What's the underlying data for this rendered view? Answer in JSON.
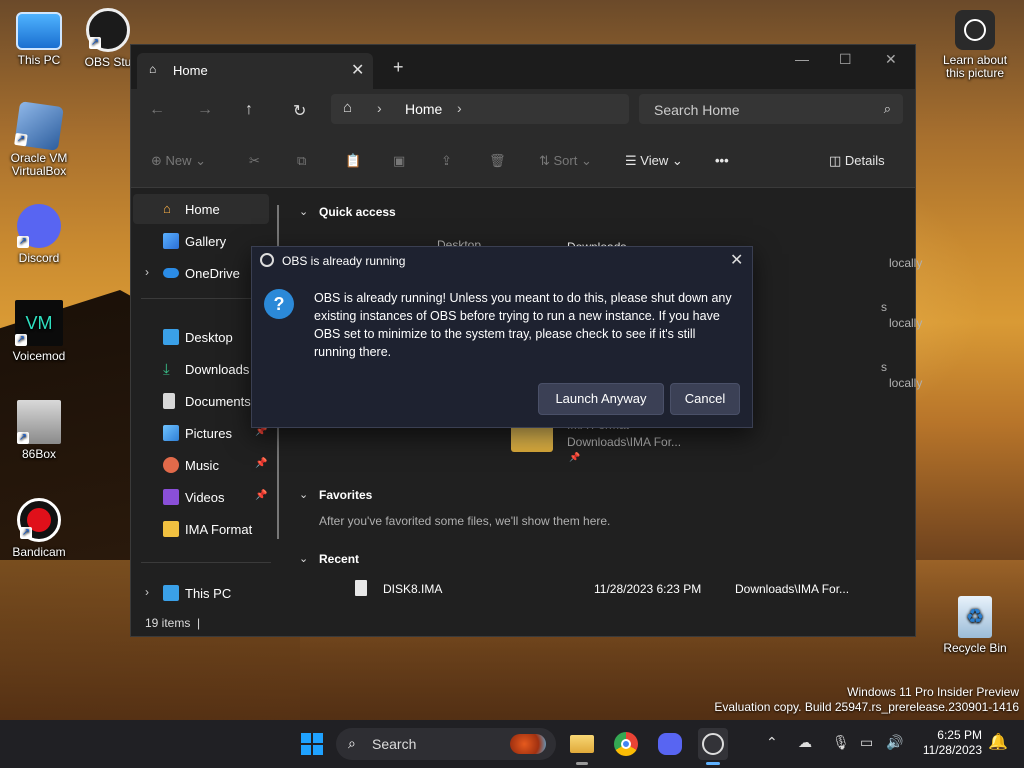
{
  "desktop": {
    "icons": [
      {
        "label": "This PC"
      },
      {
        "label": "OBS Stu"
      },
      {
        "label": "Oracle VM VirtualBox"
      },
      {
        "label": "Discord"
      },
      {
        "label": "Voicemod"
      },
      {
        "label": "86Box"
      },
      {
        "label": "Bandicam"
      },
      {
        "label": "Learn about this picture"
      },
      {
        "label": "Recycle Bin"
      }
    ],
    "watermark_line1": "Windows 11 Pro Insider Preview",
    "watermark_line2": "Evaluation copy. Build 25947.rs_prerelease.230901-1416"
  },
  "explorer": {
    "tab_title": "Home",
    "breadcrumb": "Home",
    "search_placeholder": "Search Home",
    "commands": {
      "new": "New",
      "sort": "Sort",
      "view": "View",
      "more": "•••",
      "details": "Details"
    },
    "sidebar": [
      {
        "label": "Home"
      },
      {
        "label": "Gallery"
      },
      {
        "label": "OneDrive"
      },
      {
        "label": "Desktop"
      },
      {
        "label": "Downloads"
      },
      {
        "label": "Documents"
      },
      {
        "label": "Pictures"
      },
      {
        "label": "Music"
      },
      {
        "label": "Videos"
      },
      {
        "label": "IMA Format"
      },
      {
        "label": "This PC"
      }
    ],
    "sections": {
      "quick_access": "Quick access",
      "favorites": "Favorites",
      "favorites_hint": "After you've favorited some files, we'll show them here.",
      "recent": "Recent"
    },
    "quick_items": {
      "desktop_partial": "Desktop",
      "downloads": "Downloads",
      "stored_locally": "locally",
      "partial_s": "s",
      "ima_name": "IMA Format",
      "ima_path": "Downloads\\IMA For..."
    },
    "recent_row": {
      "name": "DISK8.IMA",
      "date": "11/28/2023 6:23 PM",
      "location": "Downloads\\IMA For..."
    },
    "status": "19 items"
  },
  "dialog": {
    "title": "OBS is already running",
    "message": "OBS is already running! Unless you meant to do this, please shut down any existing instances of OBS before trying to run a new instance. If you have OBS set to minimize to the system tray, please check to see if it's still running there.",
    "launch_label": "Launch Anyway",
    "cancel_label": "Cancel"
  },
  "taskbar": {
    "search_label": "Search",
    "time": "6:25 PM",
    "date": "11/28/2023"
  }
}
